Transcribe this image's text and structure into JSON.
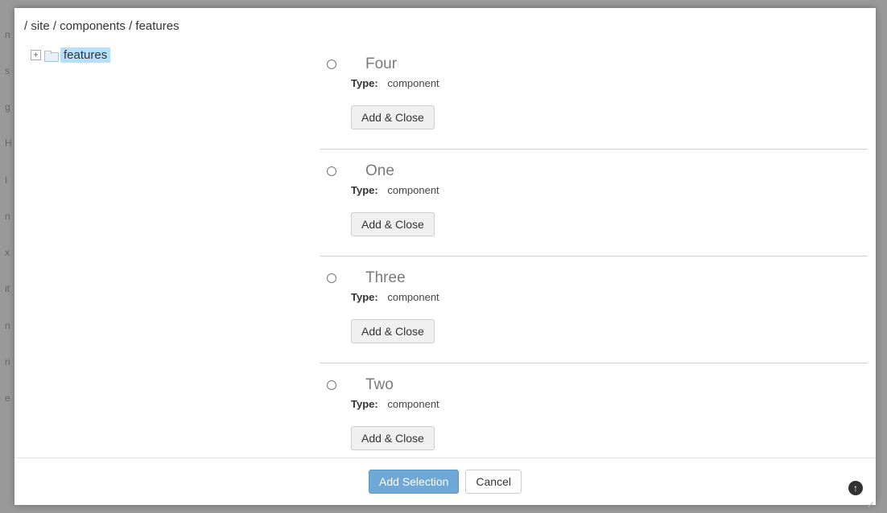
{
  "breadcrumb": "/ site / components / features",
  "sidebar": {
    "tree": {
      "label": "features"
    }
  },
  "main": {
    "type_label": "Type:",
    "add_close_label": "Add & Close",
    "items": [
      {
        "title": "Four",
        "type": "component"
      },
      {
        "title": "One",
        "type": "component"
      },
      {
        "title": "Three",
        "type": "component"
      },
      {
        "title": "Two",
        "type": "component"
      }
    ]
  },
  "footer": {
    "add_selection": "Add Selection",
    "cancel": "Cancel"
  }
}
